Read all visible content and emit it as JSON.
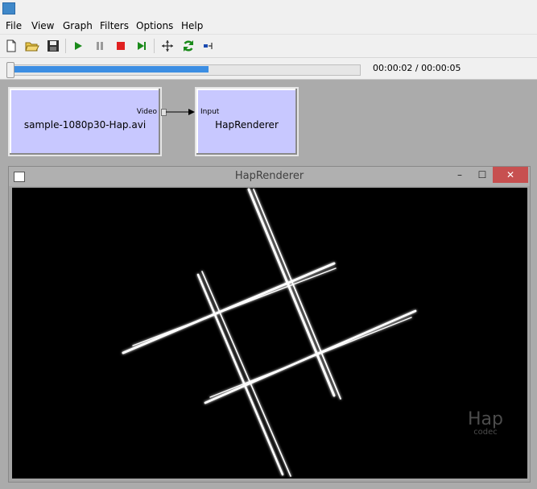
{
  "menu": [
    "File",
    "View",
    "Graph",
    "Filters",
    "Options",
    "Help"
  ],
  "toolbar": {
    "icons": [
      "new-file-icon",
      "open-folder-icon",
      "save-disk-icon",
      "play-icon",
      "pause-icon",
      "stop-icon",
      "step-frame-icon",
      "arrange-icon",
      "refresh-icon",
      "seek-mode-icon"
    ]
  },
  "seek": {
    "position": "00:00:02 / 00:00:05",
    "progress": 0.57
  },
  "graph": {
    "source_filter": {
      "name": "sample-1080p30-Hap.avi",
      "output_pin": "Video"
    },
    "renderer_filter": {
      "name": "HapRenderer",
      "input_pin": "Input"
    }
  },
  "renderer_window": {
    "title": "HapRenderer",
    "minimize": "–",
    "maximize": "☐",
    "close": "✕",
    "watermark": {
      "line1": "Hap",
      "line2": "codec"
    }
  },
  "colors": {
    "filter_fill": "#c8c8ff",
    "close_red": "#c75050",
    "play_green": "#1a8a1a",
    "stop_red": "#e02020",
    "seek_blue": "#3c8ee3"
  }
}
